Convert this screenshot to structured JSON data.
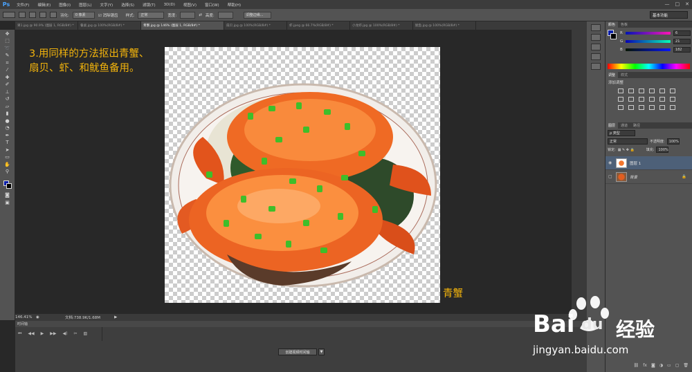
{
  "app": {
    "logo": "Ps"
  },
  "menu": [
    "文件(F)",
    "编辑(E)",
    "图像(I)",
    "图层(L)",
    "文字(Y)",
    "选择(S)",
    "滤镜(T)",
    "3D(D)",
    "视图(V)",
    "窗口(W)",
    "帮助(H)"
  ],
  "window_controls": [
    "—",
    "□",
    "✕"
  ],
  "options": {
    "feather_label": "羽化:",
    "feather_value": "0 像素",
    "antialias_label": "消除锯齿",
    "style_label": "样式:",
    "style_value": "正常",
    "width_label": "宽度:",
    "height_label": "高度:",
    "refine_button": "调整边缘...",
    "workspace": "基本功能"
  },
  "tabs": [
    "果1.jpg @ 90.9% (图层 1, RGB/8#) *",
    "餐桌.jpg @ 100%(RGB/8#) *",
    "青蟹.jpg @ 146% (图层 1, RGB/8#) *",
    "扇贝.jpg @ 100%(RGB/8#) *",
    "虾.jpeg @ 66.7%(RGB/8#) *",
    "小龙虾.jpg @ 100%(RGB/8#) *",
    "鱿鱼.jpg @ 100%(RGB/8#) *"
  ],
  "canvas": {
    "instruction_line1": "3.用同样的方法抠出青蟹、",
    "instruction_line2": "扇贝、虾、和鱿鱼备用。",
    "label": "青蟹"
  },
  "status": {
    "zoom": "146.41%",
    "doc": "文档:738.9K/1.68M"
  },
  "timeline": {
    "title": "时间轴",
    "create_button": "创建视频时间轴"
  },
  "color_panel": {
    "tabs": [
      "颜色",
      "色板"
    ],
    "r_label": "R",
    "r_value": "6",
    "g_label": "G",
    "g_value": "21",
    "b_label": "B",
    "b_value": "182"
  },
  "adjust_panel": {
    "tabs": [
      "调整",
      "样式"
    ],
    "add_label": "添加调整"
  },
  "layers_panel": {
    "tabs": [
      "图层",
      "通道",
      "路径"
    ],
    "kind": "ρ 类型",
    "blend": "正常",
    "opacity_label": "不透明度:",
    "opacity_value": "100%",
    "lock_label": "锁定:",
    "fill_label": "填充:",
    "fill_value": "100%",
    "layers": [
      {
        "name": "图层 1"
      },
      {
        "name": "背景"
      }
    ]
  },
  "watermark": {
    "brand": "Bai",
    "du": "du",
    "cn": "经验",
    "url": "jingyan.baidu.com"
  },
  "colors": {
    "accent_text": "#f3b40c",
    "foreground": "#0a1faa",
    "ui_panel": "#535353"
  }
}
